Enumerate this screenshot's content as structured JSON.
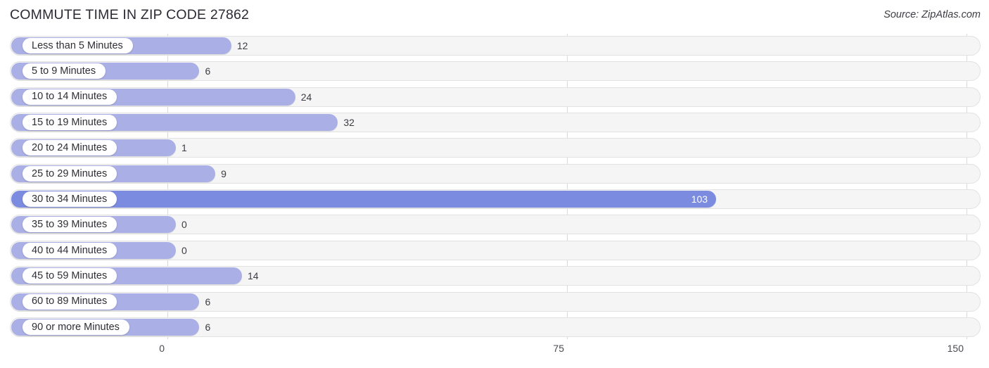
{
  "header": {
    "title": "COMMUTE TIME IN ZIP CODE 27862",
    "source": "Source: ZipAtlas.com"
  },
  "colors": {
    "bar": "#aab0e6",
    "bar_highlight": "#7b8bdf",
    "track": "#f5f5f5",
    "track_border": "#e2e2e2",
    "gridline": "#d8d8d8",
    "text": "#3c3c44",
    "title": "#2b2b33"
  },
  "axis": {
    "ticks": [
      "0",
      "75",
      "150"
    ],
    "min": 0,
    "max": 150
  },
  "chart_data": {
    "type": "bar",
    "orientation": "horizontal",
    "title": "COMMUTE TIME IN ZIP CODE 27862",
    "subtitle": "",
    "xlabel": "",
    "ylabel": "",
    "xlim": [
      0,
      150
    ],
    "xticks": [
      0,
      75,
      150
    ],
    "grid": true,
    "legend": false,
    "source": "Source: ZipAtlas.com",
    "categories": [
      "Less than 5 Minutes",
      "5 to 9 Minutes",
      "10 to 14 Minutes",
      "15 to 19 Minutes",
      "20 to 24 Minutes",
      "25 to 29 Minutes",
      "30 to 34 Minutes",
      "35 to 39 Minutes",
      "40 to 44 Minutes",
      "45 to 59 Minutes",
      "60 to 89 Minutes",
      "90 or more Minutes"
    ],
    "values": [
      12,
      6,
      24,
      32,
      1,
      9,
      103,
      0,
      0,
      14,
      6,
      6
    ],
    "value_labels": [
      "12",
      "6",
      "24",
      "32",
      "1",
      "9",
      "103",
      "0",
      "0",
      "14",
      "6",
      "6"
    ],
    "highlight_index": 6
  }
}
